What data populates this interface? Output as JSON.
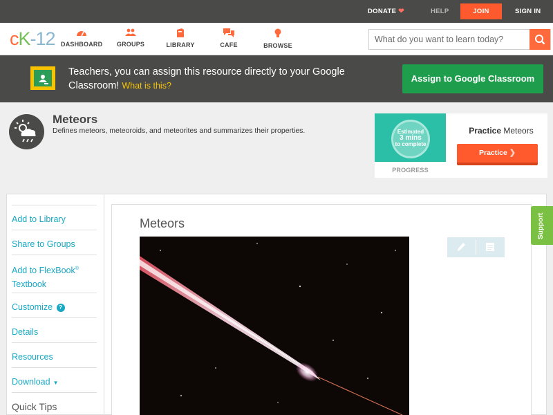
{
  "topbar": {
    "donate": "DONATE",
    "help": "HELP",
    "join": "JOIN",
    "signin": "SIGN IN"
  },
  "nav": {
    "items": [
      {
        "label": "DASHBOARD",
        "icon": "dashboard-icon"
      },
      {
        "label": "GROUPS",
        "icon": "groups-icon"
      },
      {
        "label": "LIBRARY",
        "icon": "library-icon"
      },
      {
        "label": "CAFE",
        "icon": "cafe-icon"
      },
      {
        "label": "BROWSE",
        "icon": "browse-icon"
      }
    ],
    "search_placeholder": "What do you want to learn today?"
  },
  "banner": {
    "text": "Teachers, you can assign this resource directly to your Google Classroom!",
    "link": "What is this?",
    "button": "Assign to Google Classroom"
  },
  "concept": {
    "title": "Meteors",
    "description": "Defines meteors, meteoroids, and meteorites and summarizes their properties."
  },
  "practice": {
    "estimate_line1": "Estimated",
    "estimate_line2": "3 mins",
    "estimate_line3": "to complete",
    "progress_label": "PROGRESS",
    "title_bold": "Practice",
    "title_rest": "Meteors",
    "button": "Practice"
  },
  "sidebar": {
    "items": [
      {
        "label": "Add to Library"
      },
      {
        "label": "Share to Groups"
      },
      {
        "label": "Add to FlexBook",
        "sup": "®",
        "line2": "Textbook"
      },
      {
        "label": "Customize"
      },
      {
        "label": "Details"
      },
      {
        "label": "Resources"
      },
      {
        "label": "Download"
      }
    ],
    "quick_tips": "Quick Tips"
  },
  "article": {
    "title": "Meteors"
  },
  "support": "Support",
  "colors": {
    "brand_orange": "#ff5a2d",
    "brand_green": "#1e9d4c",
    "link_blue": "#1aa8c4",
    "dark_bar": "#4a4a48"
  }
}
